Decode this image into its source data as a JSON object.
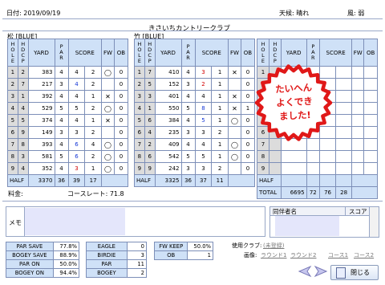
{
  "header": {
    "date_label": "日付: 2019/09/19",
    "course_name": "きさいちカントリークラブ",
    "weather_label": "天候: 晴れ",
    "wind_label": "風: 弱"
  },
  "out_course": {
    "title": "松 [BLUE]",
    "columns": [
      "HOLE",
      "HDCP",
      "YARD",
      "PAR",
      "SCORE",
      "FW",
      "OB"
    ],
    "rows": [
      {
        "hole": "1",
        "hdcp": "2",
        "yard": "383",
        "par": "4",
        "score": "4",
        "putt": "2",
        "fw": "◯",
        "ob": "0"
      },
      {
        "hole": "2",
        "hdcp": "7",
        "yard": "217",
        "par": "3",
        "score": "4",
        "putt": "2",
        "fw": "",
        "ob": "0"
      },
      {
        "hole": "3",
        "hdcp": "1",
        "yard": "392",
        "par": "4",
        "score": "4",
        "putt": "1",
        "fw": "✕",
        "ob": "0"
      },
      {
        "hole": "4",
        "hdcp": "4",
        "yard": "529",
        "par": "5",
        "score": "5",
        "putt": "2",
        "fw": "◯",
        "ob": "0"
      },
      {
        "hole": "5",
        "hdcp": "5",
        "yard": "374",
        "par": "4",
        "score": "4",
        "putt": "1",
        "fw": "✕",
        "ob": "0"
      },
      {
        "hole": "6",
        "hdcp": "9",
        "yard": "149",
        "par": "3",
        "score": "3",
        "putt": "2",
        "fw": "",
        "ob": "0"
      },
      {
        "hole": "7",
        "hdcp": "8",
        "yard": "393",
        "par": "4",
        "score": "6",
        "putt": "4",
        "fw": "◯",
        "ob": "0"
      },
      {
        "hole": "8",
        "hdcp": "3",
        "yard": "581",
        "par": "5",
        "score": "6",
        "putt": "2",
        "fw": "◯",
        "ob": "0"
      },
      {
        "hole": "9",
        "hdcp": "4",
        "yard": "352",
        "par": "4",
        "score": "3",
        "putt": "1",
        "fw": "◯",
        "ob": "0"
      }
    ],
    "half": {
      "label": "HALF",
      "yard": "3370",
      "par": "36",
      "score": "39",
      "putt": "17"
    }
  },
  "in_course": {
    "title": "竹 [BLUE]",
    "columns": [
      "HOLE",
      "HDCP",
      "YARD",
      "PAR",
      "SCORE",
      "FW",
      "OB"
    ],
    "rows": [
      {
        "hole": "1",
        "hdcp": "7",
        "yard": "410",
        "par": "4",
        "score": "3",
        "putt": "1",
        "fw": "✕",
        "ob": "0"
      },
      {
        "hole": "2",
        "hdcp": "5",
        "yard": "152",
        "par": "3",
        "score": "2",
        "putt": "1",
        "fw": "",
        "ob": "0"
      },
      {
        "hole": "3",
        "hdcp": "3",
        "yard": "401",
        "par": "4",
        "score": "4",
        "putt": "1",
        "fw": "✕",
        "ob": "0"
      },
      {
        "hole": "4",
        "hdcp": "1",
        "yard": "550",
        "par": "5",
        "score": "8",
        "putt": "1",
        "fw": "✕",
        "ob": "1"
      },
      {
        "hole": "5",
        "hdcp": "6",
        "yard": "384",
        "par": "4",
        "score": "5",
        "putt": "1",
        "fw": "◯",
        "ob": "0"
      },
      {
        "hole": "6",
        "hdcp": "4",
        "yard": "235",
        "par": "3",
        "score": "3",
        "putt": "2",
        "fw": "",
        "ob": "0"
      },
      {
        "hole": "7",
        "hdcp": "2",
        "yard": "409",
        "par": "4",
        "score": "4",
        "putt": "1",
        "fw": "◯",
        "ob": "0"
      },
      {
        "hole": "8",
        "hdcp": "6",
        "yard": "542",
        "par": "5",
        "score": "5",
        "putt": "1",
        "fw": "◯",
        "ob": "0"
      },
      {
        "hole": "9",
        "hdcp": "9",
        "yard": "242",
        "par": "3",
        "score": "3",
        "putt": "2",
        "fw": "",
        "ob": "0"
      }
    ],
    "half": {
      "label": "HALF",
      "yard": "3325",
      "par": "36",
      "score": "37",
      "putt": "11"
    }
  },
  "third_course": {
    "columns": [
      "HOLE",
      "HDCP",
      "YARD",
      "PAR",
      "SCORE",
      "FW",
      "OB"
    ],
    "rows": [
      {
        "hole": "1"
      },
      {
        "hole": "2"
      },
      {
        "hole": "3"
      },
      {
        "hole": "4"
      },
      {
        "hole": "5"
      },
      {
        "hole": "6"
      },
      {
        "hole": "7"
      },
      {
        "hole": "8"
      },
      {
        "hole": "9"
      }
    ],
    "half": {
      "label": "HALF"
    },
    "total": {
      "label": "TOTAL",
      "yard": "6695",
      "par": "72",
      "score": "76",
      "putt": "28"
    }
  },
  "stamp": {
    "line1": "たいへん",
    "line2": "よくでき",
    "line3": "ました!"
  },
  "info": {
    "fee_label": "料金:",
    "course_rate_label": "コースレート: 71.8"
  },
  "memo": {
    "label": "メモ"
  },
  "companions": {
    "name_header": "同伴者名",
    "score_header": "スコア"
  },
  "stats_left": [
    {
      "label": "PAR SAVE",
      "value": "77.8%"
    },
    {
      "label": "BOGEY SAVE",
      "value": "88.9%"
    },
    {
      "label": "PAR ON",
      "value": "50.0%"
    },
    {
      "label": "BOGEY ON",
      "value": "94.4%"
    }
  ],
  "stats_mid": [
    {
      "label": "EAGLE",
      "value": "0"
    },
    {
      "label": "BIRDIE",
      "value": "3"
    },
    {
      "label": "PAR",
      "value": "11"
    },
    {
      "label": "BOGEY",
      "value": "2"
    }
  ],
  "stats_right": [
    {
      "label": "FW KEEP",
      "value": "50.0%"
    },
    {
      "label": "OB",
      "value": "1"
    }
  ],
  "footer": {
    "club_label": "使用クラブ:",
    "club_link": "(未登録)",
    "image_label": "画像:",
    "round1": "ラウンド1",
    "round2": "ラウンド2",
    "course1": "コース1",
    "course2": "コース2",
    "close_button": "閉じる"
  },
  "colors": {
    "header_fill": "#cfe1f7",
    "border": "#7d8fb8",
    "birdie": "#d20000",
    "bogey": "#1638d6",
    "stamp": "#e01818"
  }
}
